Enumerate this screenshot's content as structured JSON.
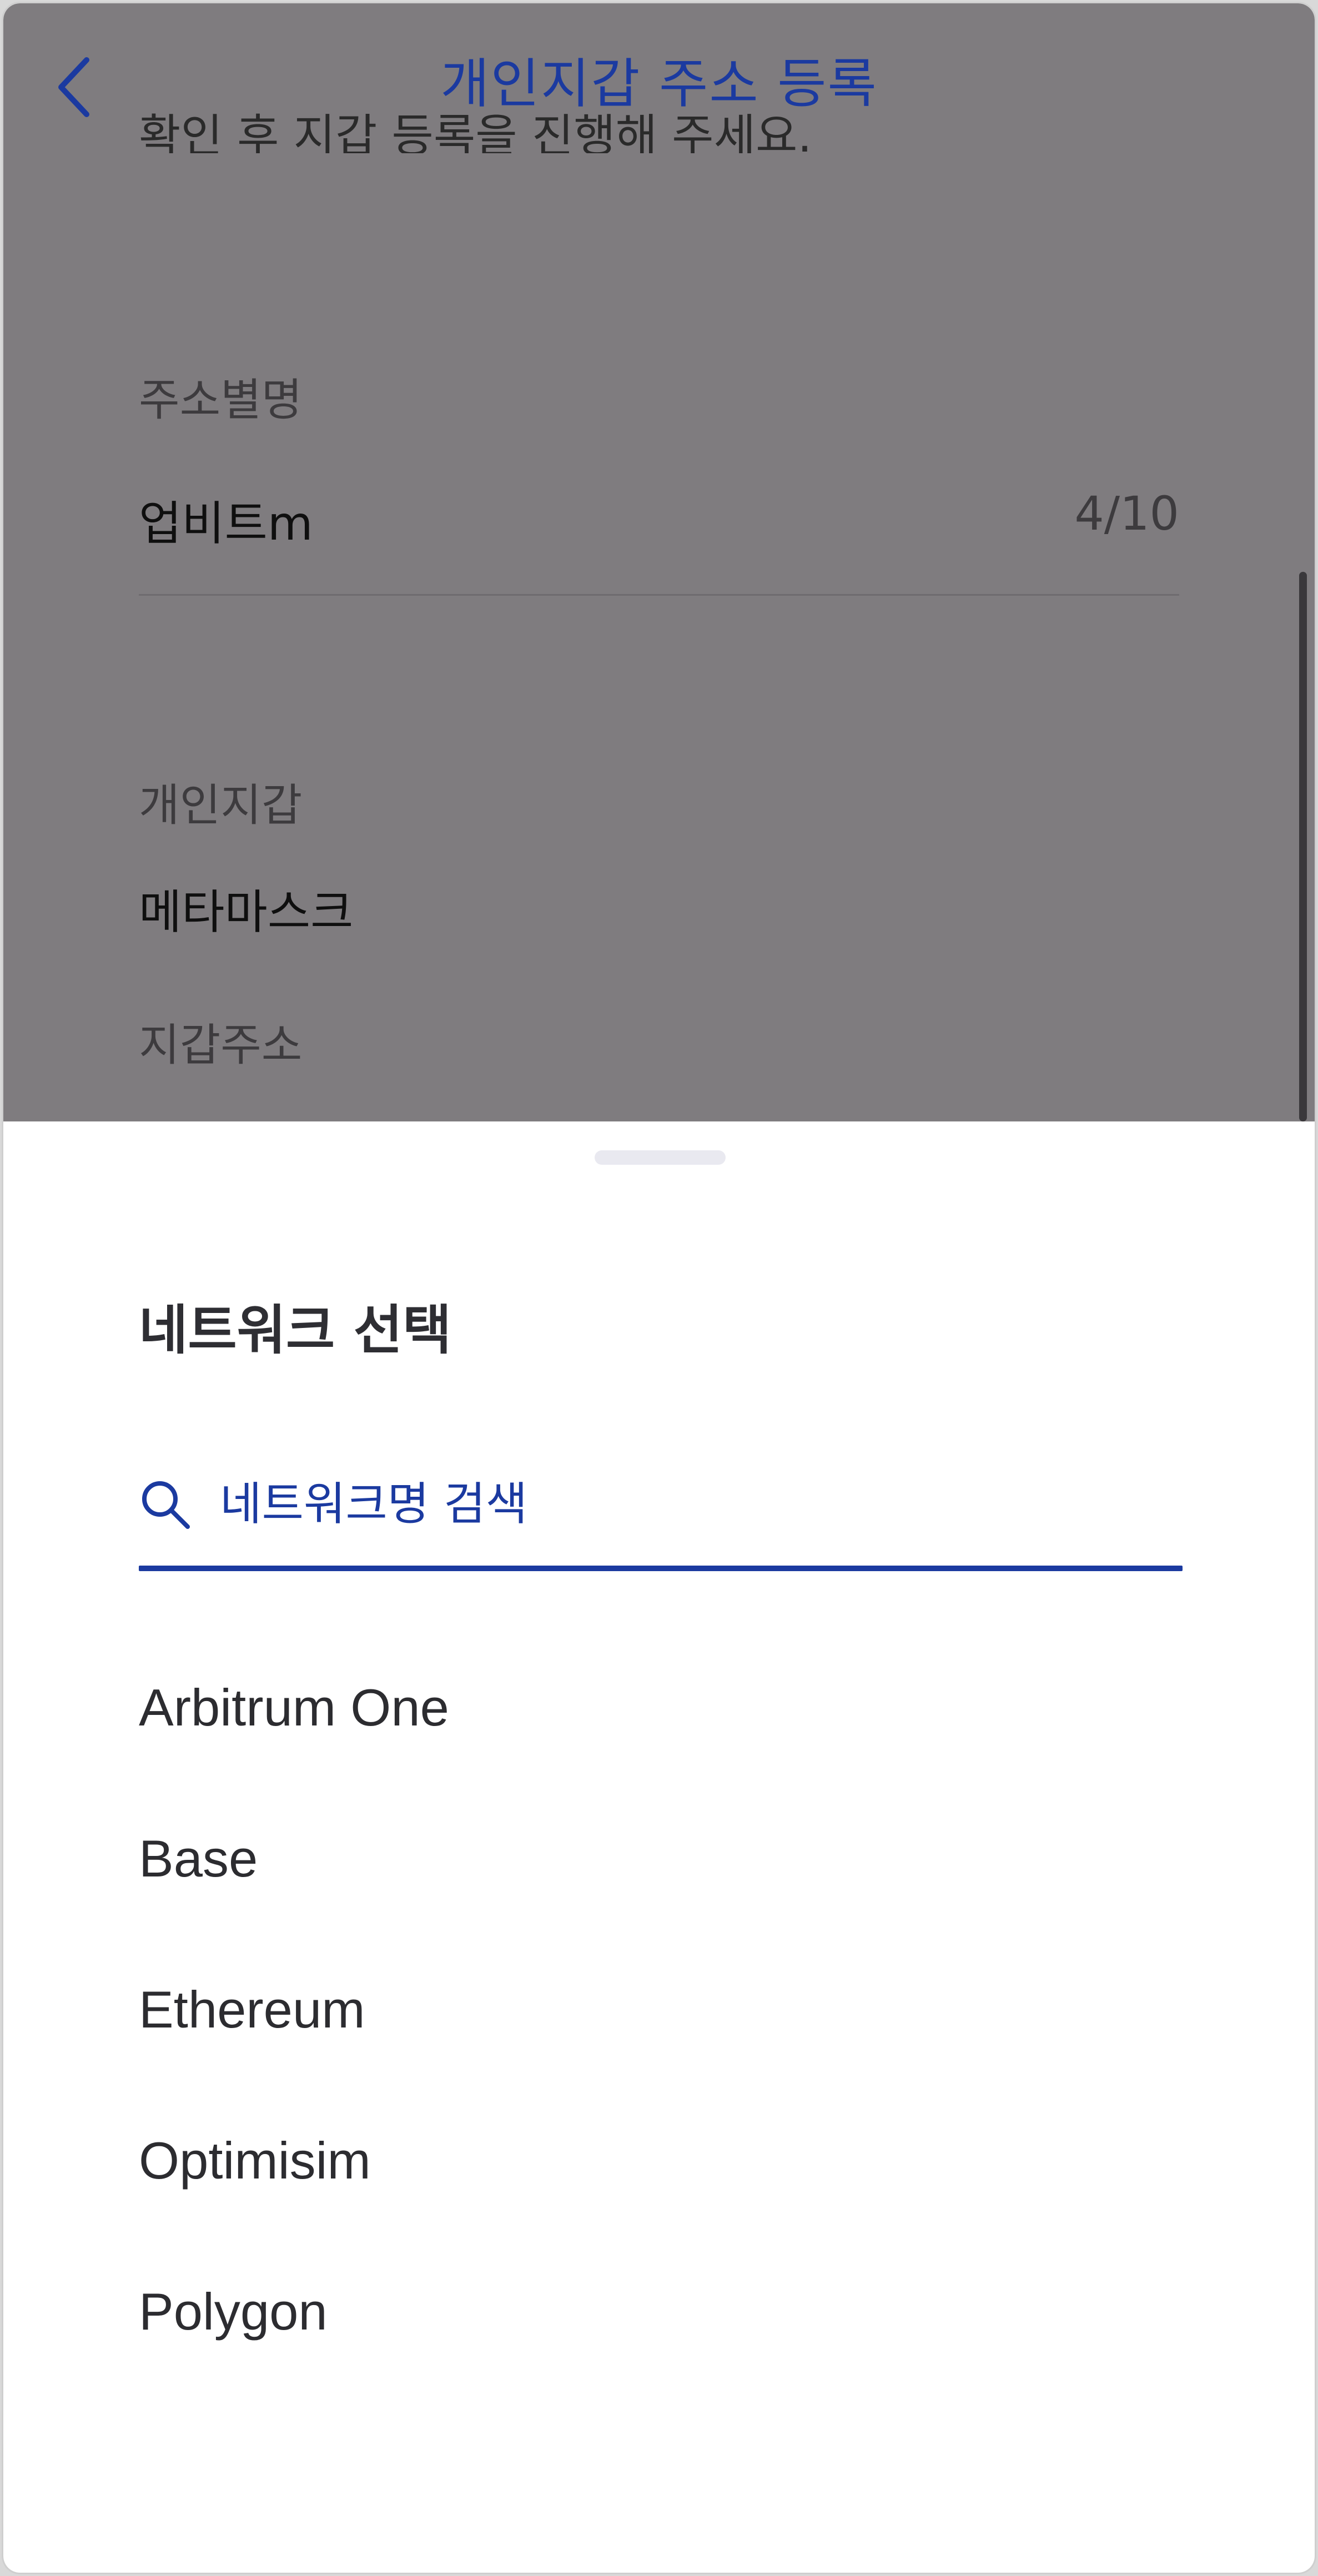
{
  "header": {
    "title": "개인지갑 주소 등록",
    "back_icon": "chevron-left-icon"
  },
  "background": {
    "partial_text": "확인 후 지갑 등록을 진행해 주세요.",
    "alias_label": "주소별명",
    "alias_value": "업비트m",
    "alias_counter": "4/10",
    "wallet_label": "개인지갑",
    "wallet_value": "메타마스크",
    "address_label": "지갑주소"
  },
  "sheet": {
    "title": "네트워크 선택",
    "search_placeholder": "네트워크명 검색",
    "networks": [
      "Arbitrum One",
      "Base",
      "Ethereum",
      "Optimisim",
      "Polygon"
    ]
  },
  "colors": {
    "accent": "#1b3aa0",
    "overlay": "#7f7c7f"
  }
}
